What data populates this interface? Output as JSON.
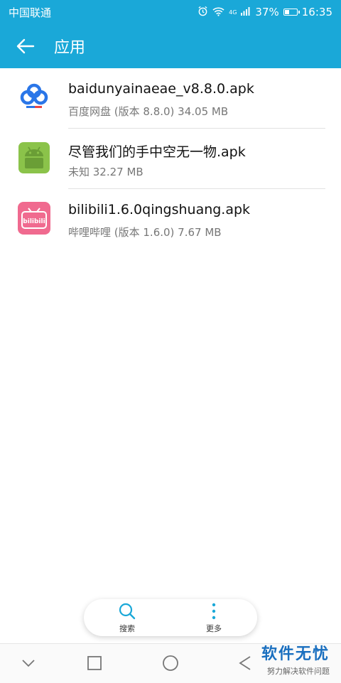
{
  "status_bar": {
    "carrier": "中国联通",
    "network": "4G",
    "battery": "37%",
    "battery_level": 0.37,
    "time": "16:35"
  },
  "app_bar": {
    "title": "应用"
  },
  "files": [
    {
      "icon": "baidu-netdisk-icon",
      "name": "baidunyainaeae_v8.8.0.apk",
      "detail": "百度网盘 (版本 8.8.0) 34.05 MB"
    },
    {
      "icon": "android-icon",
      "name": "尽管我们的手中空无一物.apk",
      "detail": "未知  32.27 MB"
    },
    {
      "icon": "bilibili-icon",
      "name": "bilibili1.6.0qingshuang.apk",
      "detail": "哔哩哔哩 (版本 1.6.0) 7.67 MB",
      "icon_text": "bilibili"
    }
  ],
  "bottom_actions": {
    "search_label": "搜索",
    "more_label": "更多"
  },
  "watermark": {
    "title": "软件无忧",
    "subtitle": "努力解决软件问题"
  },
  "colors": {
    "primary": "#1aa8d8",
    "accent": "#1aa8d8"
  }
}
